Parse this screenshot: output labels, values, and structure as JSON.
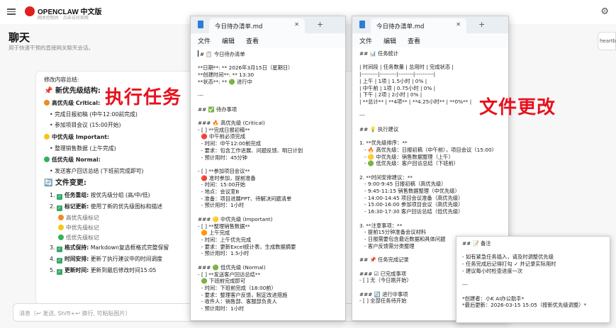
{
  "app": {
    "brand": "OPENCLAW 中文版",
    "brand_sub": "网关控制台 · 点击访问官网",
    "page_title": "聊天",
    "page_subtitle": "用于快速干预的直接网关聊天会话。",
    "side_pill": "heartb",
    "input_placeholder": "消息（↩ 发送, Shift+↩ 换行, 可粘贴图片）",
    "icons": {
      "menu": "hamburger-icon",
      "logo": "lobster-logo",
      "settings": "gear-icon"
    }
  },
  "overlays": {
    "left": "执行任务",
    "right": "文件更改",
    "color": "#e8111d"
  },
  "chat_content": {
    "intro": "修改内容总结:",
    "priority_title": "新优先级结构:",
    "high_label": "高优先级 Critical:",
    "high_items": [
      "完成日报初稿 (中午12:00前完成)",
      "参加项目会议 (15:00开始)"
    ],
    "mid_label": "中优先级 Important:",
    "mid_items": [
      "整理销售数据 (上午完成)"
    ],
    "low_label": "低优先级 Normal:",
    "low_items": [
      "发送客户回访总结 (下班前完成即可)"
    ],
    "changes_title": "文件变更:",
    "changes": [
      {
        "n": "1.",
        "label": "任务重组:",
        "text": "按优先级分组 (高/中/低)"
      },
      {
        "n": "2.",
        "label": "标记更新:",
        "text": "使用了新的优先级图标和描述"
      },
      {
        "n": "3.",
        "label": "格式保持:",
        "text": "Markdown复选框格式完整保留"
      },
      {
        "n": "4.",
        "label": "时间安排:",
        "text": "更新了执行建议中的时间调度"
      },
      {
        "n": "5.",
        "label": "更新时间:",
        "text": "更新到最后修改时间15:05"
      }
    ],
    "sub_marks": [
      "高优先级标记",
      "中优先级标记",
      "低优先级标记"
    ],
    "colors": {
      "high": "#f08a24",
      "mid": "#f5c518",
      "low": "#34b35a",
      "check": "#3aa86b"
    }
  },
  "notepad_left": {
    "tab_title": "今日待办清单.md",
    "menus": [
      "文件",
      "编辑",
      "查看"
    ],
    "lines": [
      "# 📋 今日待办清单",
      "",
      "**日期**: ** 2026年3月15日（星期日）",
      "**创建时间**: ** 13:30",
      "**状态**: ** 🟢 进行中",
      "",
      "---",
      "",
      "## ✅ 待办事项",
      "",
      "### 🔥 高优先级 (Critical)",
      "- [ ] **完成日报初稿**",
      "  🔴 中午前必须完成",
      "  - 时间：中午12:00前完成",
      "  - 要求：包含工作进展、问题反馈、明日计划",
      "  - 预计用时：45分钟",
      "",
      "- [ ] **参加项目会议**",
      "  🔴 准时参加，提前准备",
      "  - 时间：15:00开始",
      "  - 地点：会议室B",
      "  - 准备：项目进展PPT、待解决问题清单",
      "  - 预计用时：1小时",
      "",
      "### 🟡 中优先级 (Important)",
      "- [ ] **整理销售数据**",
      "  🟠 上午完成",
      "  - 时间：上午优先完成",
      "  - 要求：更新Excel统计表，生成数据摘要",
      "  - 预计用时：1.5小时",
      "",
      "### 🟢 低优先级 (Normal)",
      "- [ ] **发送客户回访总结**",
      "  🟢 下班前完成即可",
      "  - 时间：下班前完成（18:00前）",
      "  - 要求：整理客户反馈，制定改进措施",
      "  - 收件人：销售部、客服部负责人",
      "  - 预计用时：1小时"
    ]
  },
  "notepad_right": {
    "tab_title": "今日待办清单.md",
    "menus": [
      "文件",
      "编辑",
      "查看"
    ],
    "lines": [
      "## 📊 任务统计",
      "",
      "| 时间段 | 任务数量 | 总用时 | 完成状态 |",
      "|---------|---------|--------|----------|",
      "| 上午 | 1项 | 1.5小时 | 0% |",
      "| 中午前 | 1项 | 0.75小时 | 0% |",
      "| 下午 | 2项 | 2小时 | 0% |",
      "| **总计** | **4项** | **4.25小时** | **0%** |",
      "",
      "---",
      "",
      "## 💡 执行建议",
      "",
      "1. **优先级排序：**",
      "   - 🔥 高优先级：日报初稿（中午前），项目会议（15:00）",
      "   - 🟡 中优先级：销售数据整理（上午）",
      "   - 🟢 低优先级：客户回访总结（下班前）",
      "",
      "2. **时间安排建议：**",
      "   - 9:00-9:45 日报初稿（高优先级）",
      "   - 9:45-11:15 销售数据整理（中优先级）",
      "   - 14:00-14:45 项目会议准备（高优先级）",
      "   - 15:00-16:00 参加项目会议（高优先级）",
      "   - 16:30-17:30 客户回访总结（低优先级）",
      "",
      "3. **注意事项：**",
      "   - 提前15分钟准备会议材料",
      "   - 日报需要包含最近数据和具体问题",
      "   - 客户反馈需分类整理",
      "",
      "## 📌 任务完成记录",
      "",
      "### ☑ 已完成事项",
      "- [ ] 无（今日刚开始）",
      "",
      "### 🔄 进行中事项",
      "- [ ] 全部任务待开始"
    ]
  },
  "note_panel": {
    "lines": [
      "## 📝 备注",
      "",
      "- 如有紧急任务插入，请及时调整优先级",
      "- 任务完成后记得打勾 ✓ 并记录实际用时",
      "- 建议每小时检查进度一次",
      "",
      "---",
      "",
      "*创建者：小K AI办公助手*",
      "*最后更新：2026-03-15 15:05（按新优先级调整）*"
    ]
  }
}
